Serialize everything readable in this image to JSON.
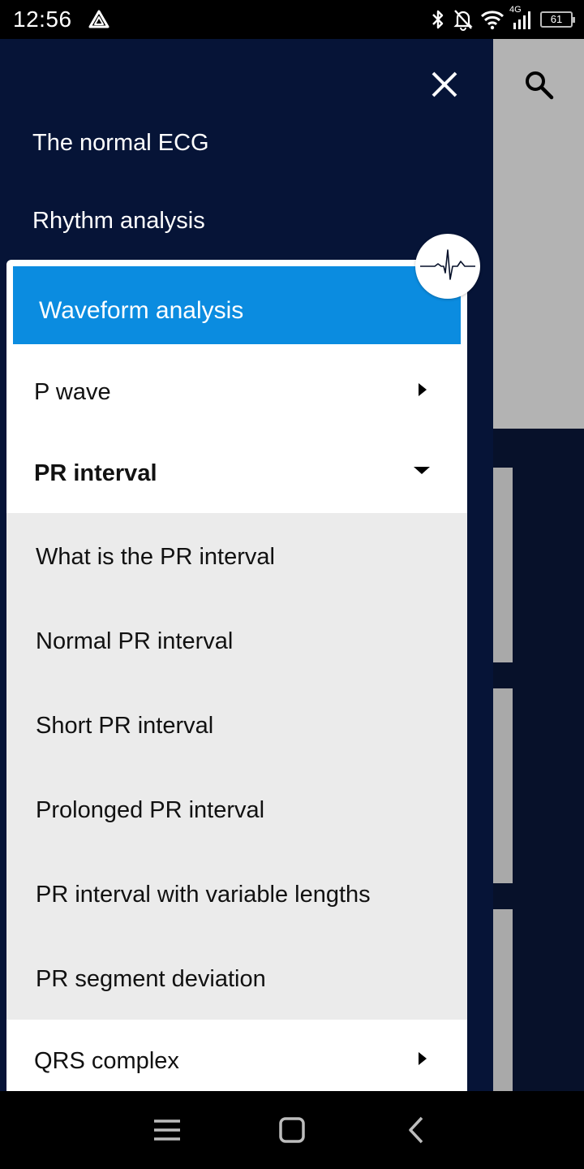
{
  "status_bar": {
    "time": "12:56",
    "network_type": "4G",
    "battery_level": "61",
    "icons": [
      "drive-icon",
      "bluetooth-icon",
      "mute-icon",
      "wifi-icon",
      "signal-icon",
      "battery-icon"
    ]
  },
  "app": {
    "search_icon": "search-icon"
  },
  "drawer": {
    "close_icon": "close-icon",
    "top_items": [
      {
        "label": "The normal ECG"
      },
      {
        "label": "Rhythm analysis"
      }
    ],
    "expanded_section": {
      "title": "Waveform analysis",
      "badge_icon": "ecg-waveform-icon",
      "groups": [
        {
          "label": "P wave",
          "state": "collapsed"
        },
        {
          "label": "PR interval",
          "state": "expanded"
        },
        {
          "label": "QRS complex",
          "state": "collapsed"
        }
      ],
      "pr_items": [
        {
          "label": "What is the PR interval"
        },
        {
          "label": "Normal PR interval"
        },
        {
          "label": "Short PR interval"
        },
        {
          "label": "Prolonged PR interval"
        },
        {
          "label": "PR interval with variable lengths"
        },
        {
          "label": "PR segment deviation"
        }
      ]
    }
  },
  "nav_bar": {
    "icons": [
      "menu-icon",
      "home-icon",
      "back-icon"
    ]
  },
  "colors": {
    "drawer_bg": "#061437",
    "header_accent": "#0b8ce0",
    "sublist_bg": "#ebebeb",
    "overlay_gray": "#b3b3b3"
  }
}
